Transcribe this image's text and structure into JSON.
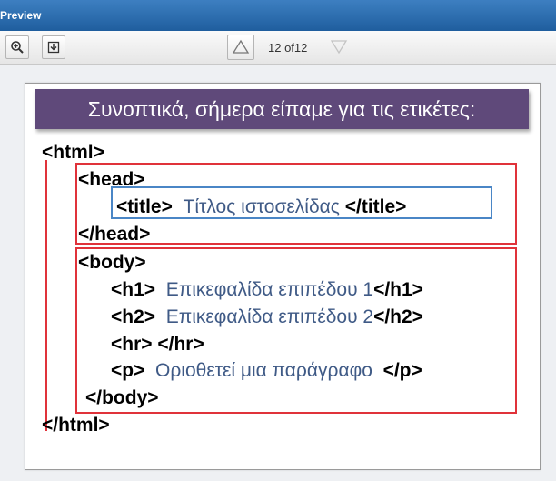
{
  "window": {
    "title": "Preview"
  },
  "toolbar": {
    "page_count": "12 of12"
  },
  "slide": {
    "heading": "Συνοπτικά, σήμερα είπαμε για τις ετικέτες:",
    "lines": {
      "html_open": "<html>",
      "head_open": "<head>",
      "title_open": "<title>",
      "title_text": "Τίτλος ιστοσελίδας",
      "title_close": "</title>",
      "head_close": "</head>",
      "body_open": "<body>",
      "h1_open": "<h1>",
      "h1_text": "Επικεφαλίδα επιπέδου 1",
      "h1_close": "</h1>",
      "h2_open": "<h2>",
      "h2_text": "Επικεφαλίδα επιπέδου 2",
      "h2_close": "</h2>",
      "hr": "<hr> </hr>",
      "p_open": "<p>",
      "p_text": "Οριοθετεί μια παράγραφο",
      "p_close": "</p>",
      "body_close": "</body>",
      "html_close": "</html>"
    }
  },
  "colors": {
    "banner": "#5f497a",
    "highlight_red": "#e0323a",
    "highlight_blue": "#4a86c6",
    "content_text": "#3f5a86"
  }
}
